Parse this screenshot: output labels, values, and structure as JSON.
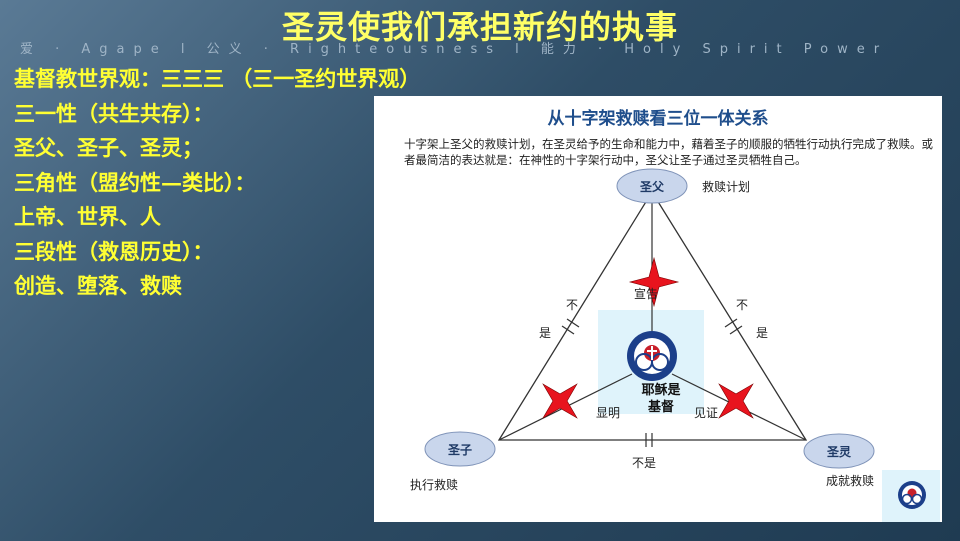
{
  "slide": {
    "title": "圣灵使我们承担新约的执事",
    "subtitle": "爱 · Agape  l  公义 · Righteousness  l  能力 · Holy Spirit Power"
  },
  "left_text": {
    "lines": [
      "基督教世界观：三三三 （三一圣约世界观）",
      "三一性（共生共存）：",
      "圣父、圣子、圣灵；",
      "三角性（盟约性—类比）：",
      "上帝、世界、人",
      "三段性（救恩历史）：",
      "创造、堕落、救赎"
    ]
  },
  "diagram": {
    "title": "从十字架救赎看三位一体关系",
    "description": "十字架上圣父的救赎计划，在圣灵给予的生命和能力中，藉着圣子的顺服的牺牲行动执行完成了救赎。或者最简洁的表达就是：在神性的十字架行动中，圣父让圣子通过圣灵牺牲自己。",
    "nodes": {
      "father": "圣父",
      "son": "圣子",
      "spirit": "圣灵"
    },
    "node_captions": {
      "father": "救赎计划",
      "son": "执行救赎",
      "spirit": "成就救赎"
    },
    "edge_labels": {
      "left_top": "不",
      "left_bottom": "是",
      "right_top": "不",
      "right_bottom": "是",
      "bottom": "不是"
    },
    "center_labels": {
      "top": "宣告",
      "left": "显明",
      "right": "见证",
      "center_line1": "耶稣是",
      "center_line2": "基督"
    },
    "colors": {
      "title_blue": "#1f4e8c",
      "node_fill": "#c9d6ec",
      "star_red": "#e8141e",
      "left_text_yellow": "#ffff33"
    }
  }
}
